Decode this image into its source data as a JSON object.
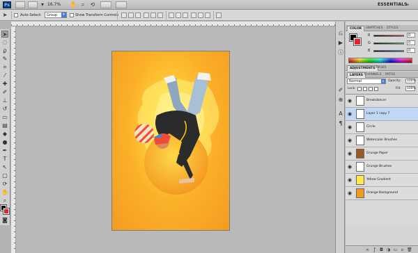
{
  "app": {
    "logo": "Ps",
    "zoom": "16.7%",
    "workspace": "ESSENTIALS"
  },
  "options": {
    "auto_select_label": "Auto-Select:",
    "auto_select_value": "Group",
    "show_transform_label": "Show Transform Controls"
  },
  "panels": {
    "color_tabs": [
      "COLOR",
      "SWATCHES",
      "STYLES"
    ],
    "sliders": [
      {
        "label": "R",
        "value": "0",
        "color": "#e23b3b"
      },
      {
        "label": "G",
        "value": "0",
        "color": "#39b54a"
      },
      {
        "label": "B",
        "value": "0",
        "color": "#3b5fe2"
      }
    ],
    "adjust_tabs": [
      "ADJUSTMENTS",
      "MASKS"
    ],
    "layer_tabs": [
      "LAYERS",
      "CHANNELS",
      "PATHS"
    ],
    "blend_mode": "Normal",
    "opacity_label": "Opacity:",
    "opacity_value": "100%",
    "lock_label": "Lock:",
    "fill_label": "Fill:",
    "fill_value": "100%"
  },
  "colors": {
    "foreground": "#000000",
    "background": "#ed1f24"
  },
  "layers": [
    {
      "name": "Breakdancer",
      "thumb": "#ffffff",
      "selected": false
    },
    {
      "name": "Layer 1 copy 7",
      "thumb": "#ffffff",
      "selected": true
    },
    {
      "name": "Circle",
      "thumb": "#ffffff",
      "selected": false
    },
    {
      "name": "Watercolor Brushes",
      "thumb": "#ffffff",
      "selected": false
    },
    {
      "name": "Grunge Paper",
      "thumb": "#9a5a24",
      "selected": false
    },
    {
      "name": "Grunge Brushes",
      "thumb": "#ffffff",
      "selected": false
    },
    {
      "name": "Yellow Gradient",
      "thumb": "#ffe94a",
      "selected": false
    },
    {
      "name": "Orange Background",
      "thumb": "#f39b21",
      "selected": false
    }
  ]
}
